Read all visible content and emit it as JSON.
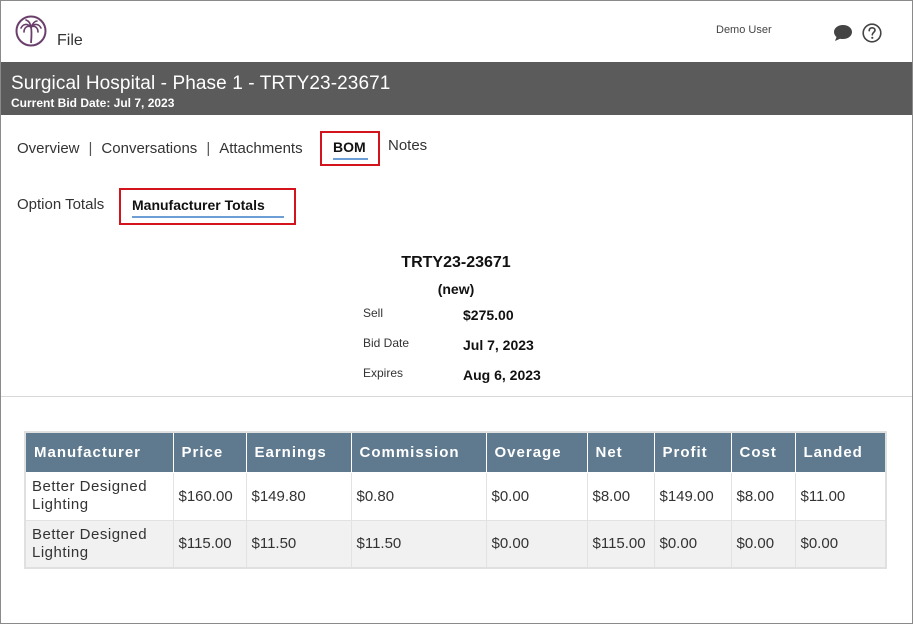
{
  "header": {
    "file_label": "File",
    "user_name": "Demo User"
  },
  "project": {
    "title": "Surgical Hospital - Phase 1 - TRTY23-23671",
    "subtitle": "Current Bid Date: Jul 7, 2023"
  },
  "tabs": {
    "overview": "Overview",
    "conversations": "Conversations",
    "attachments": "Attachments",
    "bom": "BOM",
    "notes": "Notes",
    "separator": "|"
  },
  "subtabs": {
    "option_totals": "Option Totals",
    "manufacturer_totals": "Manufacturer Totals"
  },
  "summary": {
    "bid_number": "TRTY23-23671",
    "status": "(new)",
    "sell_label": "Sell",
    "sell_value": "$275.00",
    "bid_date_label": "Bid Date",
    "bid_date_value": "Jul 7, 2023",
    "expires_label": "Expires",
    "expires_value": "Aug 6, 2023"
  },
  "table": {
    "columns": [
      "Manufacturer",
      "Price",
      "Earnings",
      "Commission",
      "Overage",
      "Net",
      "Profit",
      "Cost",
      "Landed"
    ],
    "rows": [
      [
        "Better Designed Lighting",
        "$160.00",
        "$149.80",
        "$0.80",
        "$0.00",
        "$8.00",
        "$149.00",
        "$8.00",
        "$11.00"
      ],
      [
        "Better Designed Lighting",
        "$115.00",
        "$11.50",
        "$11.50",
        "$0.00",
        "$115.00",
        "$0.00",
        "$0.00",
        "$0.00"
      ]
    ]
  },
  "colors": {
    "title_band": "#5b5b5b",
    "table_header": "#5f7a8f",
    "highlight_box": "#d4141c",
    "tab_underline": "#6b9fd6",
    "logo": "#6b3f6b"
  },
  "icons": {
    "logo": "palm-tree-logo-icon",
    "chat": "chat-bubble-icon",
    "help": "question-circle-icon"
  }
}
